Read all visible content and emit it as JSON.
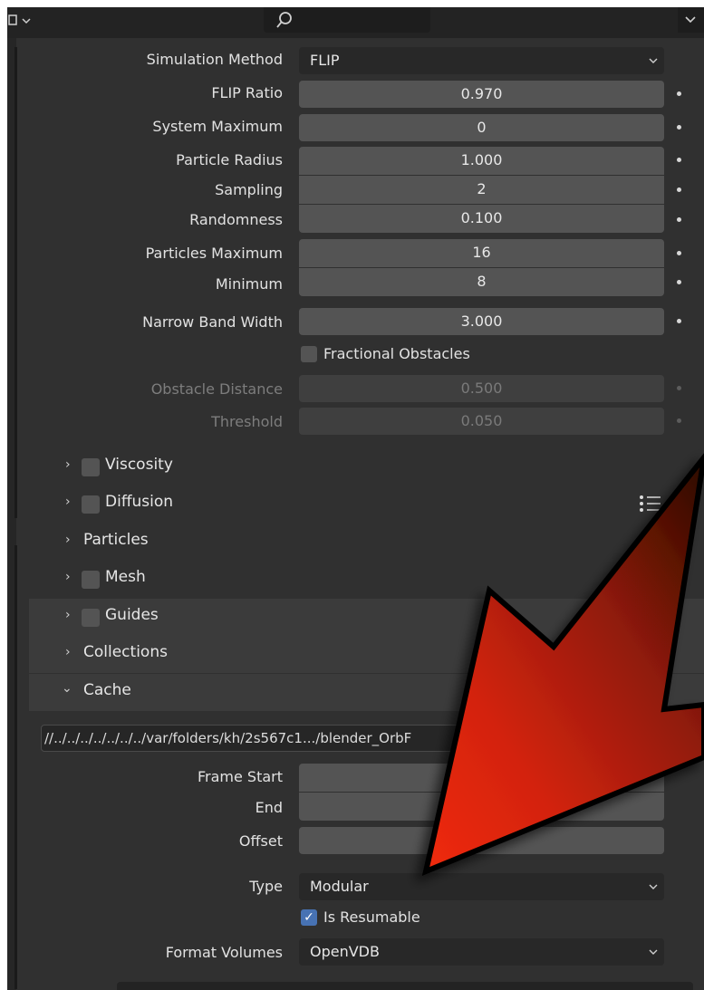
{
  "header": {
    "left_icon": "editor-type-icon",
    "search_icon": "search-icon",
    "right_icon": "chevron-down-icon"
  },
  "settings": {
    "simulation_method": {
      "label": "Simulation Method",
      "value": "FLIP"
    },
    "flip_ratio": {
      "label": "FLIP Ratio",
      "value": "0.970"
    },
    "system_maximum": {
      "label": "System Maximum",
      "value": "0"
    },
    "particle_radius": {
      "label": "Particle Radius",
      "value": "1.000"
    },
    "sampling": {
      "label": "Sampling",
      "value": "2"
    },
    "randomness": {
      "label": "Randomness",
      "value": "0.100"
    },
    "particles_maximum": {
      "label": "Particles Maximum",
      "value": "16"
    },
    "minimum": {
      "label": "Minimum",
      "value": "8"
    },
    "narrow_band_width": {
      "label": "Narrow Band Width",
      "value": "3.000"
    },
    "fractional_obstacles": {
      "label": "Fractional Obstacles",
      "checked": false
    },
    "obstacle_distance": {
      "label": "Obstacle Distance",
      "value": "0.500"
    },
    "threshold": {
      "label": "Threshold",
      "value": "0.050"
    }
  },
  "panels": [
    {
      "label": "Viscosity",
      "expanded": false,
      "checkbox": true
    },
    {
      "label": "Diffusion",
      "expanded": false,
      "checkbox": true
    },
    {
      "label": "Particles",
      "expanded": false,
      "checkbox": false
    },
    {
      "label": "Mesh",
      "expanded": false,
      "checkbox": true
    },
    {
      "label": "Guides",
      "expanded": false,
      "checkbox": true
    },
    {
      "label": "Collections",
      "expanded": false,
      "checkbox": false
    },
    {
      "label": "Cache",
      "expanded": true,
      "checkbox": false
    }
  ],
  "cache": {
    "directory": "//../../../../../../../var/folders/kh/2s567c1.../blender_OrbF",
    "frame_start": {
      "label": "Frame Start",
      "value": ""
    },
    "end": {
      "label": "End",
      "value": ""
    },
    "offset": {
      "label": "Offset",
      "value": ""
    },
    "type": {
      "label": "Type",
      "value": "Modular"
    },
    "is_resumable": {
      "label": "Is Resumable",
      "checked": true
    },
    "format_volumes": {
      "label": "Format Volumes",
      "value": "OpenVDB"
    }
  },
  "glyphs": {
    "chevron_right": "›",
    "chevron_down": "⌄",
    "check": "✓"
  },
  "colors": {
    "panel_bg": "#303030",
    "field_bg": "#545454",
    "accent_blue": "#4772b3",
    "arrow_red": "#e0260c"
  }
}
